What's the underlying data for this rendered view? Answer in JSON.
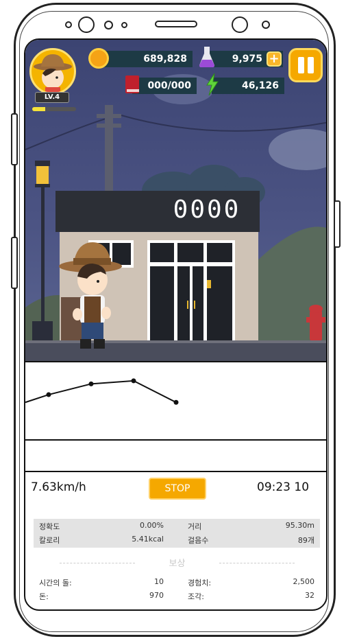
{
  "hud": {
    "coins": "689,828",
    "potion": "9,975",
    "plus": "+",
    "book_count": "000/000",
    "energy": "46,126",
    "level": "LV.4",
    "xp_fraction": 0.3
  },
  "scene": {
    "scoreboard": "0000"
  },
  "chart_data": {
    "type": "line",
    "x": [
      0,
      1,
      2,
      3,
      4
    ],
    "values": [
      2.4,
      2.9,
      3.6,
      3.8,
      2.4
    ],
    "ylim": [
      0,
      5
    ],
    "grid": false
  },
  "controls": {
    "speed": "7.63km/h",
    "stop_label": "STOP",
    "timer": "09:23 10"
  },
  "stats": {
    "accuracy_label": "정확도",
    "accuracy_value": "0.00%",
    "distance_label": "거리",
    "distance_value": "95.30m",
    "calorie_label": "칼로리",
    "calorie_value": "5.41kcal",
    "steps_label": "걸음수",
    "steps_value": "89개"
  },
  "reward": {
    "title": "보상",
    "stone_label": "시간의 돌:",
    "stone_value": "10",
    "exp_label": "경험치:",
    "exp_value": "2,500",
    "money_label": "돈:",
    "money_value": "970",
    "piece_label": "조각:",
    "piece_value": "32"
  },
  "colors": {
    "accent": "#f5a800",
    "hud_dark": "#1d3a45",
    "sky": "#4b5383"
  },
  "icons": [
    "coin-icon",
    "potion-icon",
    "plus-icon",
    "book-icon",
    "lightning-icon",
    "pause-icon"
  ]
}
